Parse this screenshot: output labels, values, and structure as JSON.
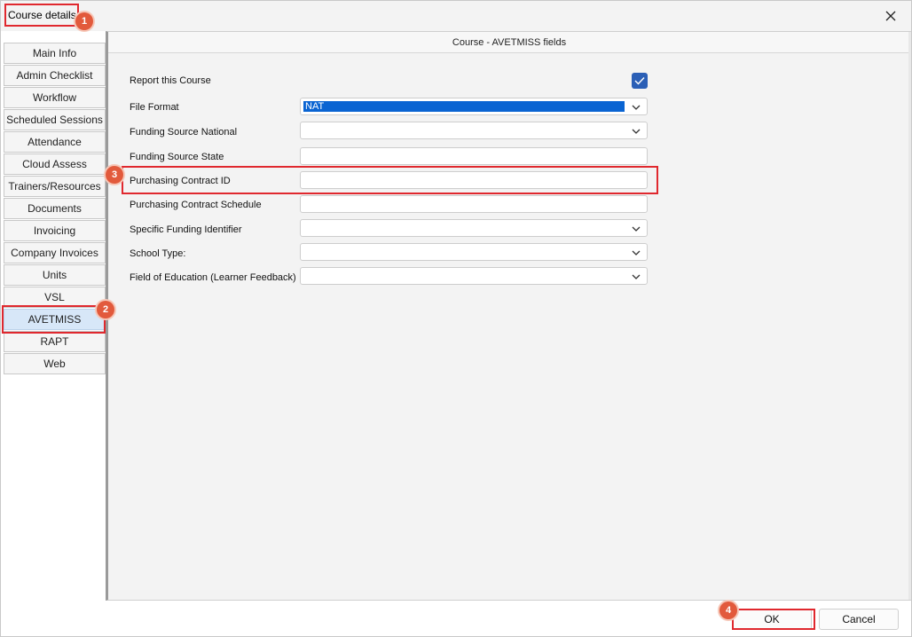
{
  "window": {
    "title": "Course details"
  },
  "tabs": [
    {
      "label": "Main Info"
    },
    {
      "label": "Admin Checklist"
    },
    {
      "label": "Workflow"
    },
    {
      "label": "Scheduled Sessions"
    },
    {
      "label": "Attendance"
    },
    {
      "label": "Cloud Assess"
    },
    {
      "label": "Trainers/Resources"
    },
    {
      "label": "Documents"
    },
    {
      "label": "Invoicing"
    },
    {
      "label": "Company Invoices"
    },
    {
      "label": "Units"
    },
    {
      "label": "VSL"
    },
    {
      "label": "AVETMISS",
      "active": true
    },
    {
      "label": "RAPT"
    },
    {
      "label": "Web"
    }
  ],
  "panel": {
    "header": "Course - AVETMISS fields",
    "fields": {
      "report_course": {
        "label": "Report this Course",
        "checked": true
      },
      "file_format": {
        "label": "File Format",
        "value": "NAT"
      },
      "funding_national": {
        "label": "Funding Source National",
        "value": ""
      },
      "funding_state": {
        "label": "Funding Source State",
        "value": ""
      },
      "purchasing_contract_id": {
        "label": "Purchasing Contract ID",
        "value": ""
      },
      "purchasing_contract_schedule": {
        "label": "Purchasing Contract Schedule",
        "value": ""
      },
      "specific_funding": {
        "label": "Specific Funding Identifier",
        "value": ""
      },
      "school_type": {
        "label": "School Type:",
        "value": ""
      },
      "field_of_education": {
        "label": "Field of Education (Learner Feedback)",
        "value": ""
      }
    }
  },
  "buttons": {
    "ok": "OK",
    "cancel": "Cancel"
  },
  "annotations": {
    "badge_1": "1",
    "badge_2": "2",
    "badge_3": "3",
    "badge_4": "4"
  },
  "colors": {
    "annotation_red": "#e0282e",
    "badge_orange": "#e25a3c",
    "selection_blue": "#0a64d2",
    "checkbox_blue": "#2b5fb6",
    "active_tab": "#d7e7f8"
  },
  "icons": {
    "close": "close-icon",
    "dropdown": "chevron-down-icon",
    "check": "checkmark-icon"
  }
}
